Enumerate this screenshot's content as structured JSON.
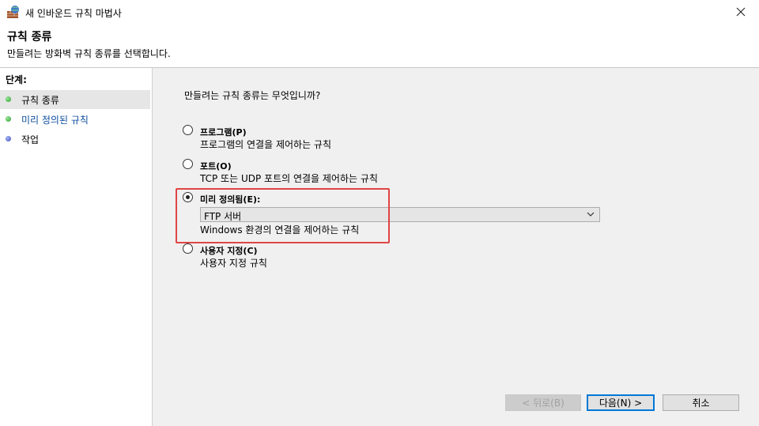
{
  "window": {
    "title": "새 인바운드 규칙 마법사"
  },
  "header": {
    "title": "규칙 종류",
    "subtitle": "만들려는 방화벽 규칙 종류를 선택합니다."
  },
  "steps": {
    "title": "단계:",
    "items": [
      {
        "label": "규칙 종류",
        "color": "#3fb23f",
        "active": true
      },
      {
        "label": "미리 정의된 규칙",
        "color": "#3fb23f",
        "active": false,
        "text_color": "#0b4c9c"
      },
      {
        "label": "작업",
        "color": "#4a5fd0",
        "active": false
      }
    ]
  },
  "main": {
    "question": "만들려는 규칙 종류는 무엇입니까?",
    "options": [
      {
        "label": "프로그램(P)",
        "desc": "프로그램의 연결을 제어하는 규칙",
        "checked": false
      },
      {
        "label": "포트(O)",
        "desc": "TCP 또는 UDP 포트의 연결을 제어하는 규칙",
        "checked": false
      },
      {
        "label": "미리 정의됨(E):",
        "desc": "Windows 환경의 연결을 제어하는 규칙",
        "checked": true,
        "dropdown_value": "FTP 서버"
      },
      {
        "label": "사용자 지정(C)",
        "desc": "사용자 지정 규칙",
        "checked": false
      }
    ]
  },
  "buttons": {
    "back": "< 뒤로(B)",
    "next": "다음(N) >",
    "cancel": "취소"
  },
  "colors": {
    "highlight": "#e04444",
    "accent": "#0078d7"
  }
}
